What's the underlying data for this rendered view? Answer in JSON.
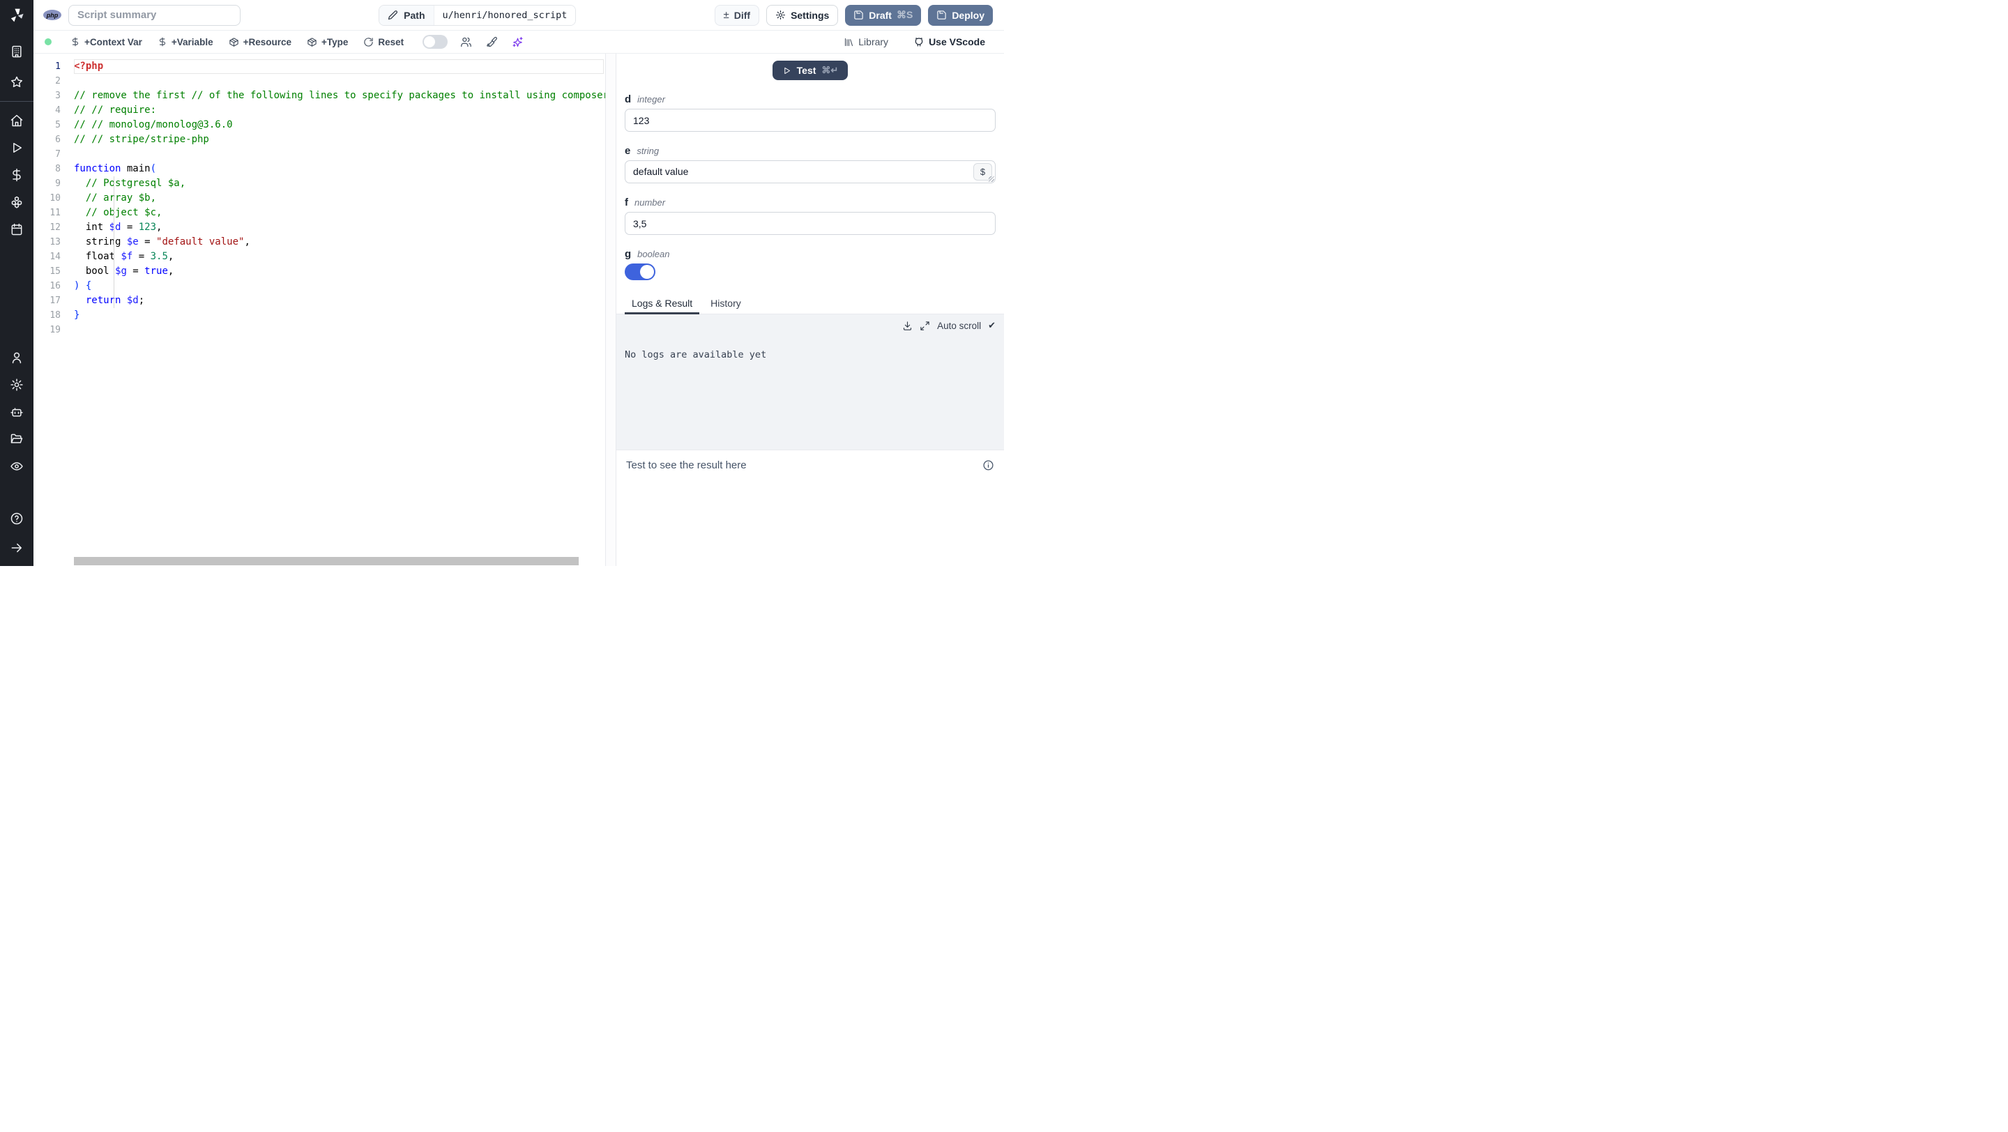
{
  "app": {
    "language_badge": "php"
  },
  "topbar": {
    "summary_placeholder": "Script summary",
    "path_label": "Path",
    "path_value": "u/henri/honored_script",
    "diff_glyph": "±",
    "diff_label": "Diff",
    "settings_label": "Settings",
    "draft_label": "Draft",
    "draft_shortcut": "⌘S",
    "deploy_label": "Deploy"
  },
  "toolbar": {
    "add_context_var": "+Context Var",
    "add_variable": "+Variable",
    "add_resource": "+Resource",
    "add_type": "+Type",
    "reset": "Reset",
    "library": "Library",
    "use_vscode": "Use VScode",
    "status_color": "#79e2a5",
    "ai_color": "#7c3aed"
  },
  "editor": {
    "language": "php",
    "lines": [
      {
        "num": 1,
        "active": true,
        "tokens": [
          {
            "t": "<?php",
            "c": "tag"
          }
        ]
      },
      {
        "num": 2,
        "tokens": []
      },
      {
        "num": 3,
        "tokens": [
          {
            "t": "// remove the first // of the following lines to specify packages to install using composer",
            "c": "comment"
          }
        ]
      },
      {
        "num": 4,
        "tokens": [
          {
            "t": "// // require:",
            "c": "comment"
          }
        ]
      },
      {
        "num": 5,
        "tokens": [
          {
            "t": "// // monolog/monolog@3.6.0",
            "c": "comment"
          }
        ]
      },
      {
        "num": 6,
        "tokens": [
          {
            "t": "// // stripe/stripe-php",
            "c": "comment"
          }
        ]
      },
      {
        "num": 7,
        "tokens": []
      },
      {
        "num": 8,
        "tokens": [
          {
            "t": "function",
            "c": "kw"
          },
          {
            "t": " main",
            "c": "plain"
          },
          {
            "t": "(",
            "c": "bracket"
          }
        ]
      },
      {
        "num": 9,
        "tokens": [
          {
            "t": "  ",
            "c": "plain"
          },
          {
            "t": "// Postgresql $a,",
            "c": "comment"
          }
        ]
      },
      {
        "num": 10,
        "tokens": [
          {
            "t": "  ",
            "c": "plain"
          },
          {
            "t": "// array $b,",
            "c": "comment"
          }
        ]
      },
      {
        "num": 11,
        "tokens": [
          {
            "t": "  ",
            "c": "plain"
          },
          {
            "t": "// object $c,",
            "c": "comment"
          }
        ]
      },
      {
        "num": 12,
        "tokens": [
          {
            "t": "  int ",
            "c": "plain"
          },
          {
            "t": "$d",
            "c": "var"
          },
          {
            "t": " = ",
            "c": "plain"
          },
          {
            "t": "123",
            "c": "num"
          },
          {
            "t": ",",
            "c": "plain"
          }
        ]
      },
      {
        "num": 13,
        "tokens": [
          {
            "t": "  string ",
            "c": "plain"
          },
          {
            "t": "$e",
            "c": "var"
          },
          {
            "t": " = ",
            "c": "plain"
          },
          {
            "t": "\"default value\"",
            "c": "str"
          },
          {
            "t": ",",
            "c": "plain"
          }
        ]
      },
      {
        "num": 14,
        "tokens": [
          {
            "t": "  float ",
            "c": "plain"
          },
          {
            "t": "$f",
            "c": "var"
          },
          {
            "t": " = ",
            "c": "plain"
          },
          {
            "t": "3.5",
            "c": "num"
          },
          {
            "t": ",",
            "c": "plain"
          }
        ]
      },
      {
        "num": 15,
        "tokens": [
          {
            "t": "  bool ",
            "c": "plain"
          },
          {
            "t": "$g",
            "c": "var"
          },
          {
            "t": " = ",
            "c": "plain"
          },
          {
            "t": "true",
            "c": "kw"
          },
          {
            "t": ",",
            "c": "plain"
          }
        ]
      },
      {
        "num": 16,
        "tokens": [
          {
            "t": ") {",
            "c": "bracket"
          }
        ]
      },
      {
        "num": 17,
        "tokens": [
          {
            "t": "  ",
            "c": "plain"
          },
          {
            "t": "return",
            "c": "kw"
          },
          {
            "t": " ",
            "c": "plain"
          },
          {
            "t": "$d",
            "c": "var"
          },
          {
            "t": ";",
            "c": "plain"
          }
        ]
      },
      {
        "num": 18,
        "tokens": [
          {
            "t": "}",
            "c": "bracket"
          }
        ]
      },
      {
        "num": 19,
        "tokens": []
      }
    ]
  },
  "panel": {
    "test_label": "Test",
    "test_shortcut": "⌘↵",
    "fields": [
      {
        "name": "d",
        "type": "integer",
        "widget": "input",
        "value": "123"
      },
      {
        "name": "e",
        "type": "string",
        "widget": "textarea",
        "value": "default value",
        "suffix": "$"
      },
      {
        "name": "f",
        "type": "number",
        "widget": "input",
        "value": "3,5"
      },
      {
        "name": "g",
        "type": "boolean",
        "widget": "toggle",
        "value": true
      }
    ],
    "tabs": [
      {
        "label": "Logs & Result",
        "active": true
      },
      {
        "label": "History",
        "active": false
      }
    ],
    "logs": {
      "auto_scroll_label": "Auto scroll",
      "auto_scroll_checked": "✔",
      "empty_message": "No logs are available yet"
    },
    "result": {
      "placeholder": "Test to see the result here"
    }
  },
  "colors": {
    "slate_button": "#5e7496",
    "test_button": "#36435c",
    "toggle_on": "#3e63dd",
    "php_badge": "#8892bf"
  }
}
